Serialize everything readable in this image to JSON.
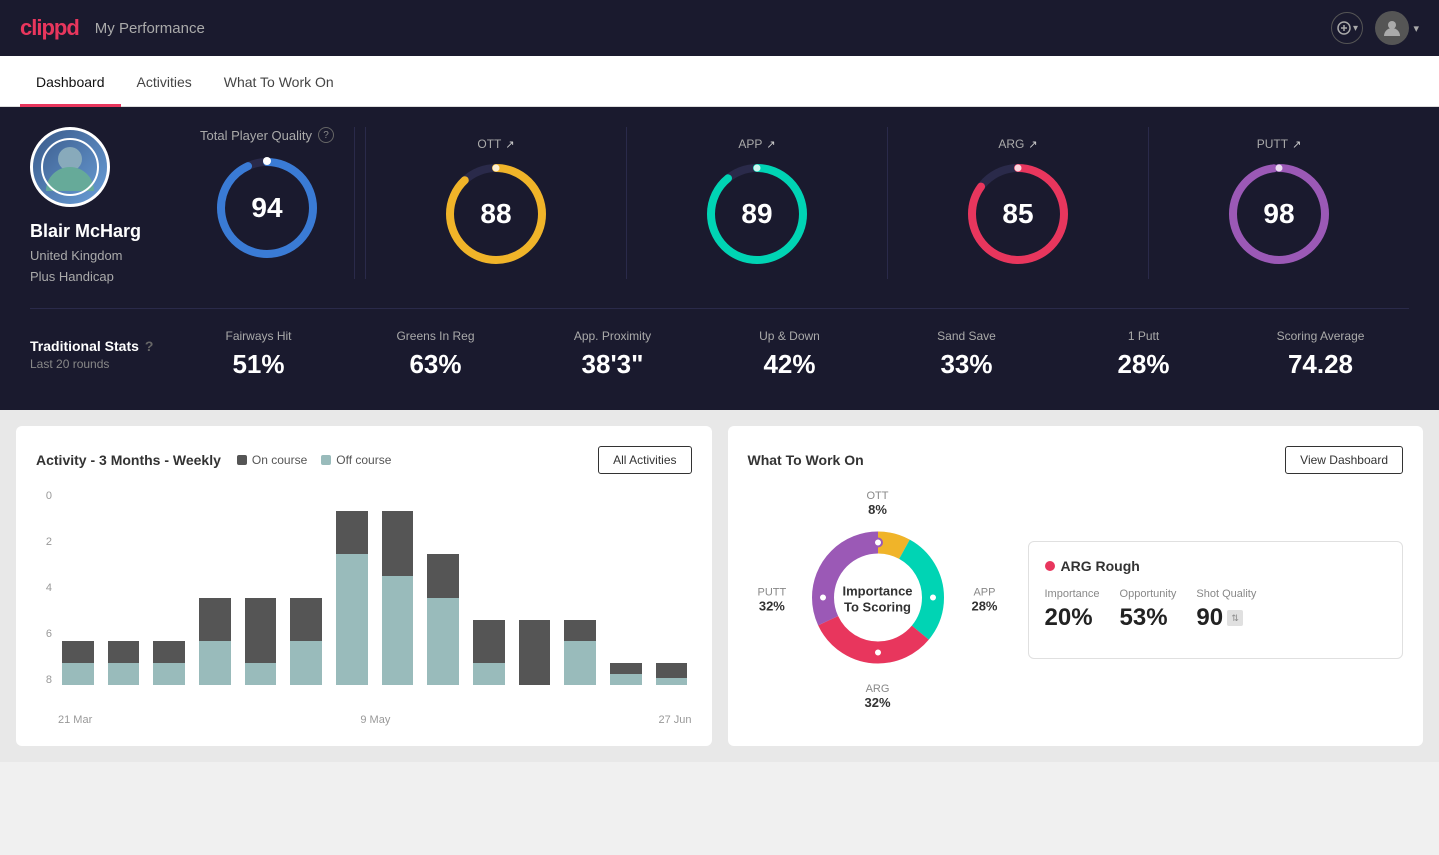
{
  "app": {
    "logo": "clippd",
    "header_title": "My Performance"
  },
  "tabs": [
    {
      "id": "dashboard",
      "label": "Dashboard",
      "active": true
    },
    {
      "id": "activities",
      "label": "Activities",
      "active": false
    },
    {
      "id": "what_to_work_on",
      "label": "What To Work On",
      "active": false
    }
  ],
  "player": {
    "name": "Blair McHarg",
    "country": "United Kingdom",
    "handicap": "Plus Handicap"
  },
  "total_player_quality": {
    "label": "Total Player Quality",
    "value": 94
  },
  "score_cards": [
    {
      "id": "ott",
      "label": "OTT",
      "value": 88,
      "color": "#f0b429",
      "trail": "#2a2a4a",
      "percent": 88
    },
    {
      "id": "app",
      "label": "APP",
      "value": 89,
      "color": "#00d4b4",
      "trail": "#2a2a4a",
      "percent": 89
    },
    {
      "id": "arg",
      "label": "ARG",
      "value": 85,
      "color": "#e8365d",
      "trail": "#2a2a4a",
      "percent": 85
    },
    {
      "id": "putt",
      "label": "PUTT",
      "value": 98,
      "color": "#9b59b6",
      "trail": "#2a2a4a",
      "percent": 98
    }
  ],
  "traditional_stats": {
    "label": "Traditional Stats",
    "sublabel": "Last 20 rounds",
    "items": [
      {
        "name": "Fairways Hit",
        "value": "51%"
      },
      {
        "name": "Greens In Reg",
        "value": "63%"
      },
      {
        "name": "App. Proximity",
        "value": "38'3\""
      },
      {
        "name": "Up & Down",
        "value": "42%"
      },
      {
        "name": "Sand Save",
        "value": "33%"
      },
      {
        "name": "1 Putt",
        "value": "28%"
      },
      {
        "name": "Scoring Average",
        "value": "74.28"
      }
    ]
  },
  "activity_chart": {
    "title": "Activity - 3 Months - Weekly",
    "legend": {
      "on_course": "On course",
      "off_course": "Off course"
    },
    "all_activities_btn": "All Activities",
    "x_labels": [
      "21 Mar",
      "9 May",
      "27 Jun"
    ],
    "y_labels": [
      "0",
      "2",
      "4",
      "6",
      "8"
    ],
    "bars": [
      {
        "on": 1,
        "off": 1
      },
      {
        "on": 1,
        "off": 1
      },
      {
        "on": 1,
        "off": 1
      },
      {
        "on": 2,
        "off": 2
      },
      {
        "on": 3,
        "off": 1
      },
      {
        "on": 2,
        "off": 2
      },
      {
        "on": 2,
        "off": 6
      },
      {
        "on": 3,
        "off": 5
      },
      {
        "on": 2,
        "off": 4
      },
      {
        "on": 2,
        "off": 1
      },
      {
        "on": 3,
        "off": 0
      },
      {
        "on": 1,
        "off": 2
      },
      {
        "on": 0.5,
        "off": 0.5
      },
      {
        "on": 0.7,
        "off": 0.3
      }
    ]
  },
  "what_to_work_on": {
    "title": "What To Work On",
    "view_dashboard_btn": "View Dashboard",
    "donut": {
      "center_line1": "Importance",
      "center_line2": "To Scoring",
      "segments": [
        {
          "label": "OTT",
          "percent": 8,
          "color": "#f0b429"
        },
        {
          "label": "APP",
          "percent": 28,
          "color": "#00d4b4"
        },
        {
          "label": "ARG",
          "percent": 32,
          "color": "#e8365d"
        },
        {
          "label": "PUTT",
          "percent": 32,
          "color": "#9b59b6"
        }
      ]
    },
    "info_card": {
      "category": "ARG Rough",
      "metrics": [
        {
          "label": "Importance",
          "value": "20%"
        },
        {
          "label": "Opportunity",
          "value": "53%"
        },
        {
          "label": "Shot Quality",
          "value": "90"
        }
      ]
    }
  }
}
